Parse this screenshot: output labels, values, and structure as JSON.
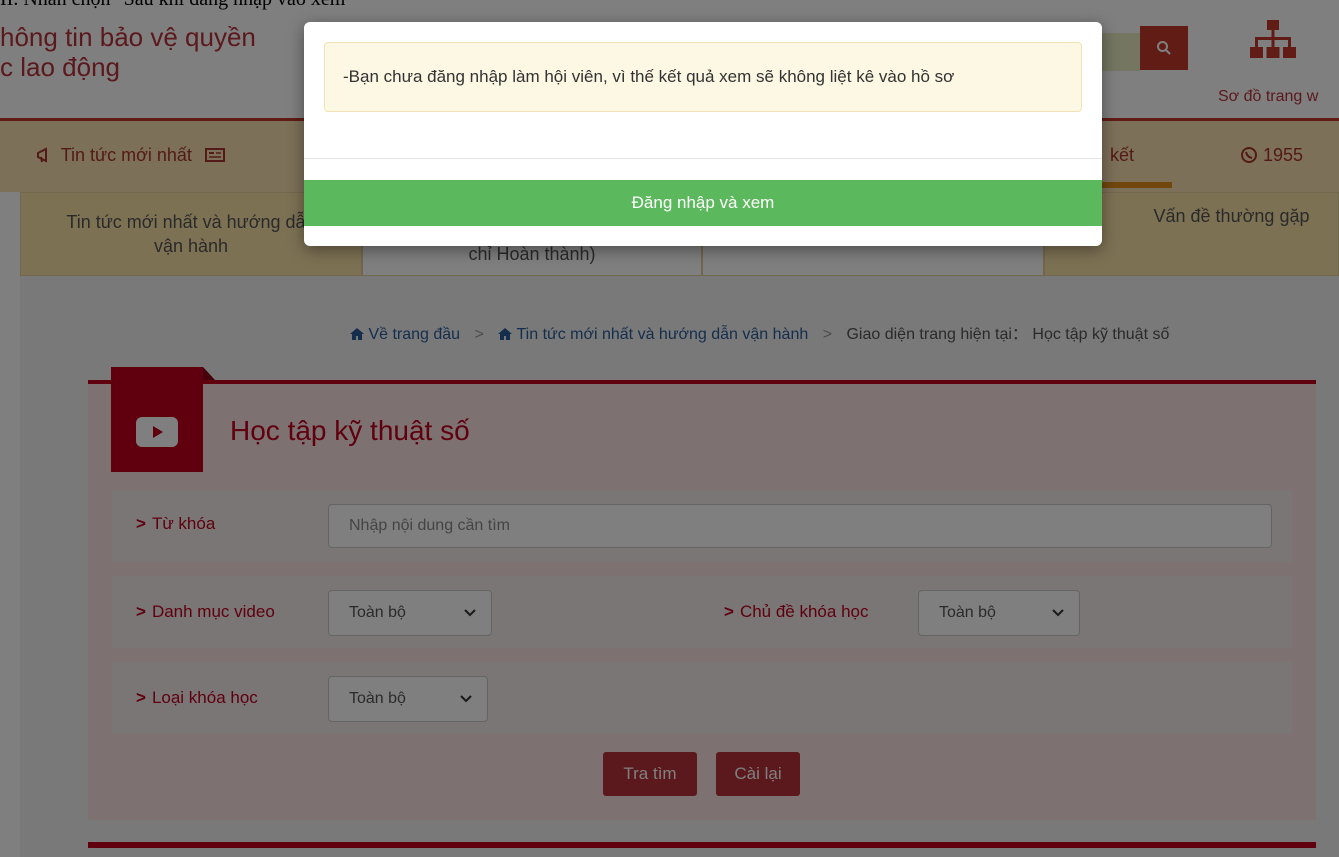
{
  "caption": "II. Nhấn chọn \"Sau khi đăng nhập vào xem\"",
  "site": {
    "title_line1": "hông tin bảo vệ quyền",
    "title_line2": "c lao động",
    "sitemap_label": "Sơ đồ trang w"
  },
  "nav": {
    "latest_news": "Tin tức mới nhất",
    "partial_right": "kết",
    "hotline": "1955"
  },
  "subtabs": [
    {
      "label": "Tin tức mới nhất và hướng dẫn vận hành"
    },
    {
      "label": "chỉ Hoàn thành)"
    },
    {
      "label": ""
    },
    {
      "label": "Vấn đề thường gặp"
    }
  ],
  "breadcrumb": {
    "home": "Về trang đầu",
    "section": "Tin tức mới nhất và hướng dẫn vận hành",
    "current_prefix": "Giao diện trang hiện tại：",
    "current": "Học tập kỹ thuật số"
  },
  "page_title": "Học tập kỹ thuật số",
  "form": {
    "keyword_label": "Từ khóa",
    "keyword_placeholder": "Nhập nội dung cần tìm",
    "video_category_label": "Danh mục video",
    "video_category_value": "Toàn bộ",
    "course_topic_label": "Chủ đề khóa học",
    "course_topic_value": "Toàn bộ",
    "course_type_label": "Loại khóa học",
    "course_type_value": "Toàn bộ",
    "search_button": "Tra tìm",
    "reset_button": "Cài lại"
  },
  "modal": {
    "message": "-Bạn chưa đăng nhập làm hội viên, vì thế kết quả xem sẽ không liệt kê vào hồ sơ",
    "login_button": "Đăng nhập và xem"
  },
  "colors": {
    "brand_red": "#c0001f",
    "button_red": "#b8323a",
    "nav_bg": "#f8e0b0",
    "login_green": "#5cb85c"
  }
}
